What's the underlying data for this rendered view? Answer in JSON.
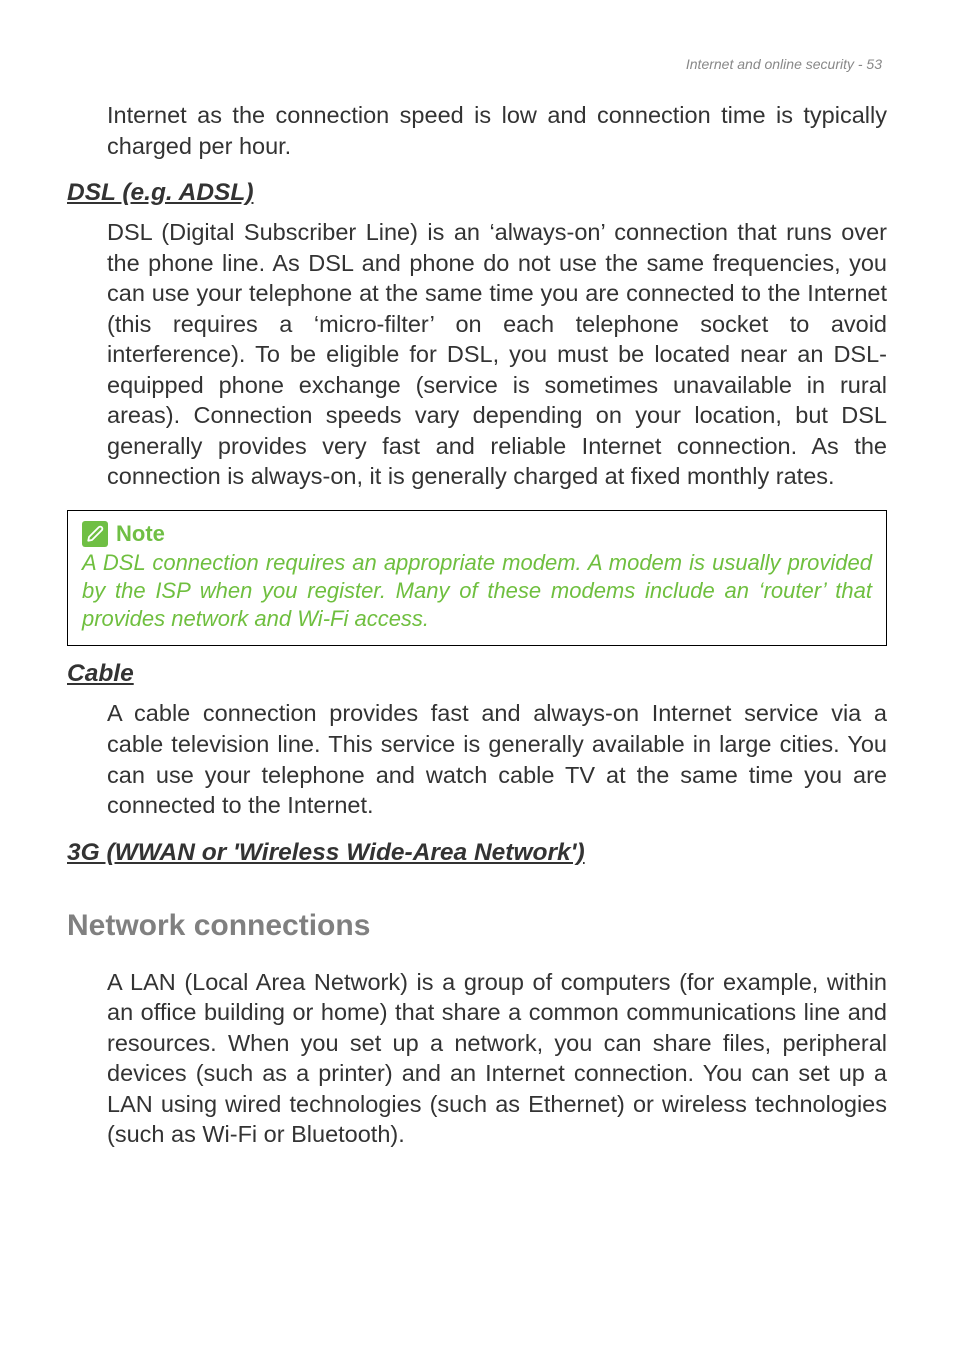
{
  "header": {
    "running_title": "Internet and online security - 53"
  },
  "intro_continuation": "Internet as the connection speed is low and connection time is typically charged per hour.",
  "dsl": {
    "heading": "DSL (e.g. ADSL)",
    "body": "DSL (Digital Subscriber Line) is an ‘always-on’ connection that runs over the phone line. As DSL and phone do not use the same frequencies, you can use your telephone at the same time you are connected to the Internet (this requires a ‘micro-filter’ on each telephone socket to avoid interference). To be eligible for DSL, you must be located near an DSL-equipped phone exchange (service is sometimes unavailable in rural areas). Connection speeds vary depending on your location, but DSL generally provides very fast and reliable Internet connection. As the connection is always-on, it is generally charged at fixed monthly rates."
  },
  "note": {
    "label": "Note",
    "body": "A DSL connection requires an appropriate modem. A modem is usually provided by the ISP when you register. Many of these modems include an ‘router’ that provides network and Wi-Fi access."
  },
  "cable": {
    "heading": "Cable",
    "body": "A cable connection provides fast and always-on Internet service via a cable television line. This service is generally available in large cities. You can use your telephone and watch cable TV at the same time you are connected to the Internet."
  },
  "wwan": {
    "heading": "3G (WWAN or 'Wireless Wide-Area Network')"
  },
  "network_connections": {
    "heading": "Network connections",
    "body": "A LAN (Local Area Network) is a group of computers (for example, within an office building or home) that share a common communications line and resources. When you set up a network, you can share files, peripheral devices (such as a printer) and an Internet connection. You can set up a LAN using wired technologies (such as Ethernet) or wireless technologies (such as Wi-Fi or Bluetooth)."
  }
}
